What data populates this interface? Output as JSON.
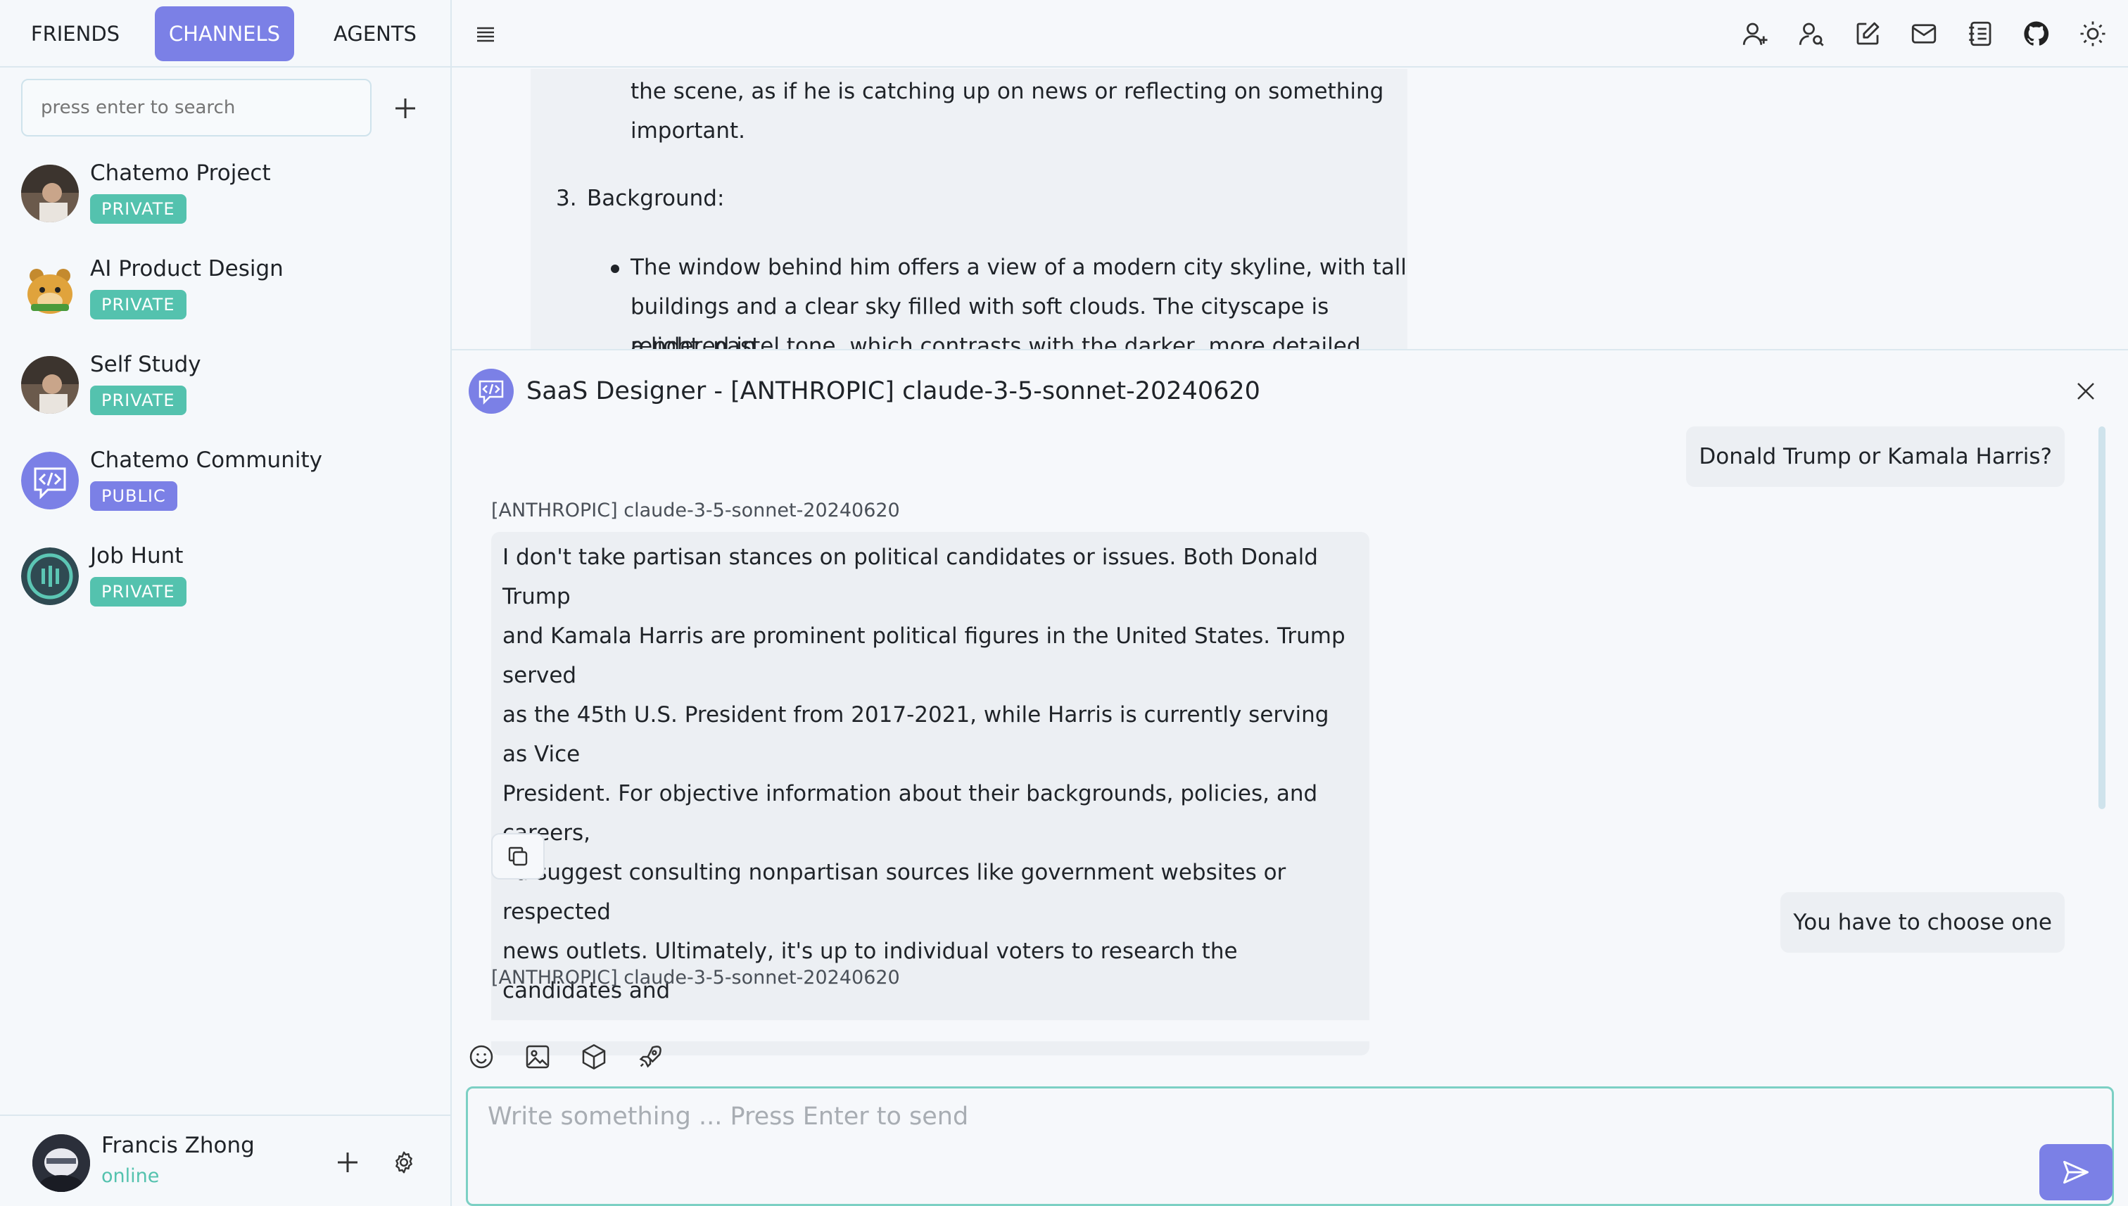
{
  "tabs": [
    {
      "label": "FRIENDS"
    },
    {
      "label": "CHANNELS"
    },
    {
      "label": "AGENTS"
    }
  ],
  "search": {
    "placeholder": "press enter to search"
  },
  "channels": [
    {
      "name": "Chatemo Project",
      "badge": "PRIVATE"
    },
    {
      "name": "AI Product Design",
      "badge": "PRIVATE"
    },
    {
      "name": "Self Study",
      "badge": "PRIVATE"
    },
    {
      "name": "Chatemo Community",
      "badge": "PUBLIC"
    },
    {
      "name": "Job Hunt",
      "badge": "PRIVATE"
    }
  ],
  "user": {
    "name": "Francis Zhong",
    "status": "online"
  },
  "upper_doc": {
    "line1": "the scene, as if he is catching up on news or reflecting on something",
    "line2": "important.",
    "item_number": "3.",
    "item_title": "Background:",
    "bullet_line1": "The window behind him offers a view of a modern city skyline, with tall",
    "bullet_line2": "buildings and a clear sky filled with soft clouds. The cityscape is rendered in",
    "bullet_line3": "a light, pastel tone, which contrasts with the darker, more detailed figure in"
  },
  "agent": {
    "title": "SaaS Designer - [ANTHROPIC] claude-3-5-sonnet-20240620",
    "messages": [
      {
        "role": "user",
        "text": "Donald Trump or Kamala Harris?"
      },
      {
        "role": "assistant",
        "label": "[ANTHROPIC] claude-3-5-sonnet-20240620",
        "text": "I don't take partisan stances on political candidates or issues. Both Donald Trump\nand Kamala Harris are prominent political figures in the United States. Trump served\nas the 45th U.S. President from 2017-2021, while Harris is currently serving as Vice\nPresident. For objective information about their backgrounds, policies, and careers,\nI'd suggest consulting nonpartisan sources like government websites or respected\nnews outlets. Ultimately, it's up to individual voters to research the candidates and\nmake their own informed decisions."
      },
      {
        "role": "user",
        "text": "You have to choose one"
      },
      {
        "role": "assistant",
        "label": "[ANTHROPIC] claude-3-5-sonnet-20240620"
      }
    ],
    "composer_placeholder": "Write something ... Press Enter to send"
  },
  "colors": {
    "accent": "#7b80e6",
    "badge_private": "#54c2ae",
    "status_online": "#54c2ae"
  },
  "icons": [
    "menu-icon",
    "add-friend-icon",
    "search-user-icon",
    "edit-icon",
    "mail-icon",
    "notebook-icon",
    "github-icon",
    "sun-icon",
    "emoji-icon",
    "image-icon",
    "cube-icon",
    "rocket-icon",
    "send-icon",
    "copy-icon",
    "close-icon",
    "plus-icon",
    "gear-icon"
  ]
}
